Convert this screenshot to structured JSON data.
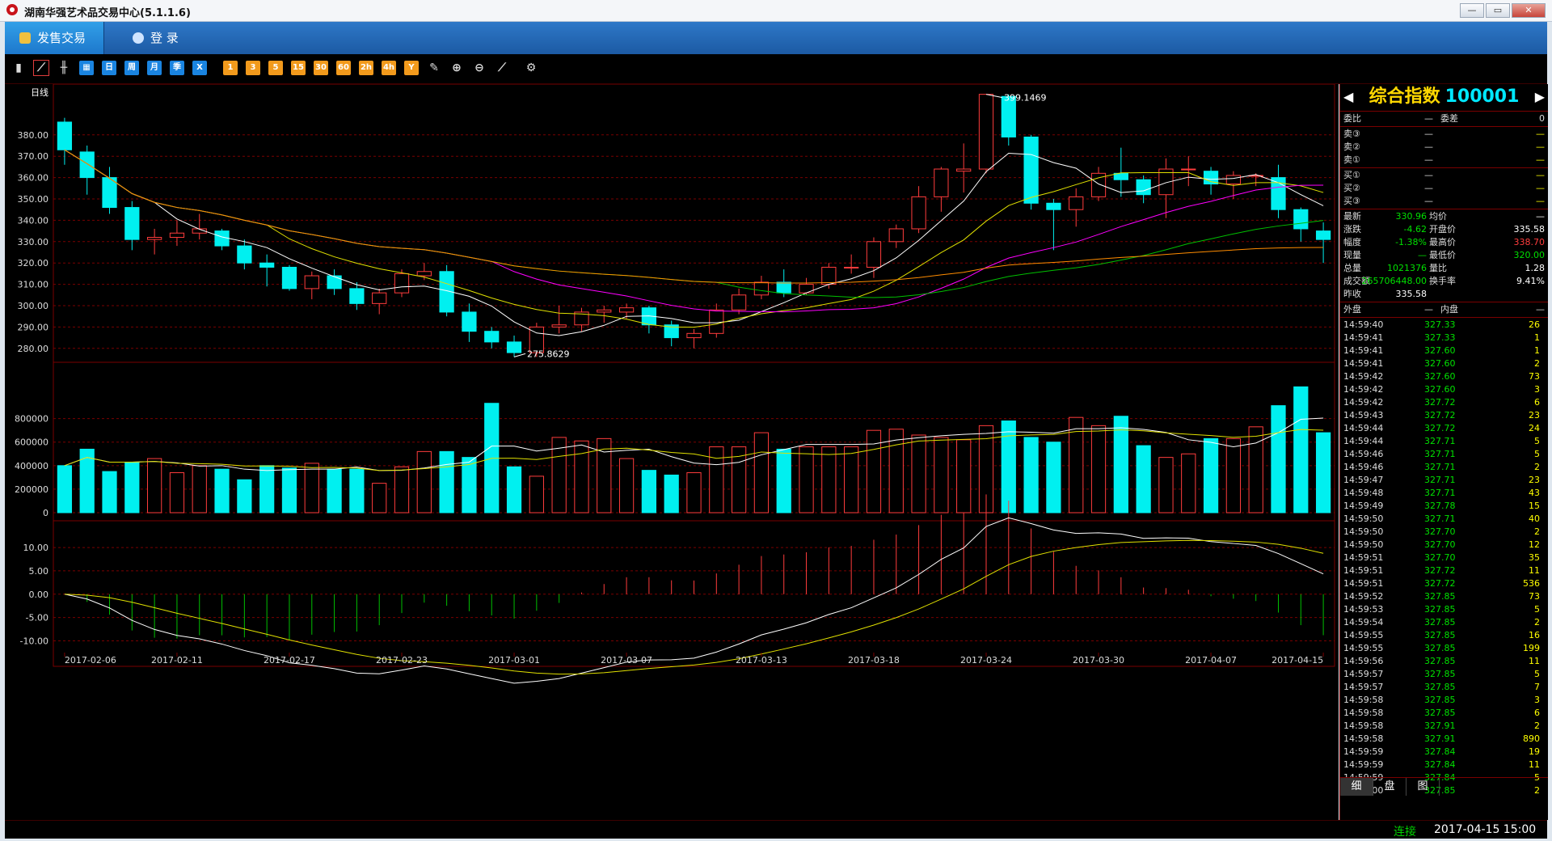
{
  "app": {
    "title": "湖南华强艺术品交易中心(5.1.1.6)",
    "win_buttons": [
      "—",
      "▭",
      "✕"
    ]
  },
  "menu": {
    "active_tab": "发售交易",
    "login_tab": "登   录"
  },
  "toolbar": {
    "buttons": [
      "bar-chart",
      "line-chart",
      "candle",
      "calendar",
      "日",
      "周",
      "月",
      "季",
      "X",
      "1",
      "3",
      "5",
      "15",
      "30",
      "60",
      "2h",
      "4h",
      "Y",
      "edit",
      "zoom-in",
      "zoom-out",
      "draw",
      "settings"
    ],
    "selected": "line-chart"
  },
  "chart": {
    "period_label": "日线",
    "price_axis": [
      "380.00",
      "370.00",
      "360.00",
      "350.00",
      "340.00",
      "330.00",
      "320.00",
      "310.00",
      "300.00",
      "290.00",
      "280.00"
    ],
    "high_label": "399.1469",
    "low_label": "275.8629",
    "volume_axis": [
      "800000",
      "600000",
      "400000",
      "200000",
      "0"
    ],
    "macd_axis": [
      "10.00",
      "5.00",
      "0.00",
      "-5.00",
      "-10.00"
    ],
    "date_axis": [
      "2017-02-06",
      "2017-02-11",
      "2017-02-17",
      "2017-02-23",
      "2017-03-01",
      "2017-03-07",
      "2017-03-13",
      "2017-03-18",
      "2017-03-24",
      "2017-03-30",
      "2017-04-07",
      "2017-04-15"
    ],
    "colors": {
      "up": "#ff3c3c",
      "down": "#00f0f0",
      "ma5": "#ffffff",
      "ma10": "#e0e000",
      "ma20": "#ff00ff",
      "ma30": "#00c000",
      "ma60": "#ff8c00"
    }
  },
  "chart_data": {
    "type": "candlestick",
    "ylim": [
      275,
      400
    ],
    "candles": [
      [
        386,
        373,
        388,
        366
      ],
      [
        372,
        360,
        375,
        352
      ],
      [
        360,
        346,
        365,
        343
      ],
      [
        346,
        331,
        349,
        326
      ],
      [
        331,
        332,
        336,
        324
      ],
      [
        332,
        334,
        340,
        328
      ],
      [
        334,
        336,
        343,
        331
      ],
      [
        335,
        328,
        336,
        326
      ],
      [
        328,
        320,
        331,
        317
      ],
      [
        320,
        318,
        324,
        309
      ],
      [
        318,
        308,
        319,
        307
      ],
      [
        308,
        314,
        316,
        303
      ],
      [
        314,
        308,
        317,
        305
      ],
      [
        308,
        301,
        311,
        298
      ],
      [
        301,
        306,
        308,
        296
      ],
      [
        306,
        315,
        317,
        304
      ],
      [
        314,
        316,
        320,
        312
      ],
      [
        316,
        297,
        319,
        295
      ],
      [
        297,
        288,
        301,
        283
      ],
      [
        288,
        283,
        290,
        280
      ],
      [
        283,
        278,
        286,
        276
      ],
      [
        278,
        290,
        292,
        276
      ],
      [
        290,
        291,
        300,
        287
      ],
      [
        291,
        297,
        299,
        288
      ],
      [
        297,
        298,
        300,
        292
      ],
      [
        297,
        299,
        301,
        294
      ],
      [
        299,
        291,
        300,
        287
      ],
      [
        291,
        285,
        293,
        281
      ],
      [
        285,
        287,
        289,
        280
      ],
      [
        287,
        298,
        301,
        285
      ],
      [
        298,
        305,
        308,
        296
      ],
      [
        305,
        311,
        314,
        303
      ],
      [
        311,
        306,
        317,
        304
      ],
      [
        306,
        310,
        313,
        305
      ],
      [
        310,
        318,
        320,
        308
      ],
      [
        318,
        318,
        324,
        315
      ],
      [
        318,
        330,
        332,
        313
      ],
      [
        330,
        336,
        338,
        327
      ],
      [
        336,
        351,
        356,
        334
      ],
      [
        351,
        364,
        365,
        344
      ],
      [
        363,
        364,
        376,
        353
      ],
      [
        364,
        399,
        399,
        362
      ],
      [
        398,
        379,
        399,
        375
      ],
      [
        379,
        348,
        380,
        345
      ],
      [
        348,
        345,
        350,
        326
      ],
      [
        345,
        351,
        355,
        337
      ],
      [
        351,
        362,
        365,
        349
      ],
      [
        362,
        359,
        374,
        351
      ],
      [
        359,
        352,
        361,
        348
      ],
      [
        352,
        364,
        369,
        341
      ],
      [
        364,
        364,
        370,
        356
      ],
      [
        363,
        357,
        365,
        352
      ],
      [
        357,
        361,
        363,
        350
      ],
      [
        361,
        361,
        362,
        356
      ],
      [
        360,
        345,
        366,
        341
      ],
      [
        345,
        336,
        346,
        330
      ],
      [
        335,
        331,
        339,
        320
      ]
    ],
    "volumes": [
      400000,
      540000,
      350000,
      430000,
      460000,
      340000,
      400000,
      370000,
      280000,
      400000,
      380000,
      420000,
      370000,
      370000,
      250000,
      390000,
      520000,
      520000,
      470000,
      930000,
      390000,
      310000,
      640000,
      610000,
      630000,
      460000,
      360000,
      320000,
      340000,
      560000,
      560000,
      680000,
      540000,
      560000,
      560000,
      560000,
      700000,
      710000,
      660000,
      640000,
      620000,
      740000,
      780000,
      640000,
      600000,
      810000,
      740000,
      820000,
      570000,
      470000,
      500000,
      630000,
      630000,
      730000,
      910000,
      1070000,
      680000
    ],
    "volume_unit_note": "",
    "macd_range": [
      -12,
      14
    ]
  },
  "quote": {
    "name": "综合指数",
    "code": "100001",
    "wb_label": "委比",
    "wb_val": "—",
    "wc_label": "委差",
    "wc_val": "0",
    "sells": [
      [
        "卖③",
        "—",
        "—"
      ],
      [
        "卖②",
        "—",
        "—"
      ],
      [
        "卖①",
        "—",
        "—"
      ]
    ],
    "buys": [
      [
        "买①",
        "—",
        "—"
      ],
      [
        "买②",
        "—",
        "—"
      ],
      [
        "买③",
        "—",
        "—"
      ]
    ],
    "stats": [
      [
        "最新",
        "330.96",
        "均价",
        "—"
      ],
      [
        "涨跌",
        "-4.62",
        "开盘价",
        "335.58"
      ],
      [
        "幅度",
        "-1.38%",
        "最高价",
        "338.70"
      ],
      [
        "现量",
        "—",
        "最低价",
        "320.00"
      ],
      [
        "总量",
        "1021376",
        "量比",
        "1.28"
      ],
      [
        "成交额",
        "265706448.00",
        "换手率",
        "9.41%"
      ],
      [
        "昨收",
        "335.58",
        "",
        ""
      ]
    ],
    "outer_label": "外盘",
    "outer_val": "—",
    "inner_label": "内盘",
    "inner_val": "—",
    "ticks": [
      [
        "14:59:40",
        "327.33",
        "26"
      ],
      [
        "14:59:41",
        "327.33",
        "1"
      ],
      [
        "14:59:41",
        "327.60",
        "1"
      ],
      [
        "14:59:41",
        "327.60",
        "2"
      ],
      [
        "14:59:42",
        "327.60",
        "73"
      ],
      [
        "14:59:42",
        "327.60",
        "3"
      ],
      [
        "14:59:42",
        "327.72",
        "6"
      ],
      [
        "14:59:43",
        "327.72",
        "23"
      ],
      [
        "14:59:44",
        "327.72",
        "24"
      ],
      [
        "14:59:44",
        "327.71",
        "5"
      ],
      [
        "14:59:46",
        "327.71",
        "5"
      ],
      [
        "14:59:46",
        "327.71",
        "2"
      ],
      [
        "14:59:47",
        "327.71",
        "23"
      ],
      [
        "14:59:48",
        "327.71",
        "43"
      ],
      [
        "14:59:49",
        "327.78",
        "15"
      ],
      [
        "14:59:50",
        "327.71",
        "40"
      ],
      [
        "14:59:50",
        "327.70",
        "2"
      ],
      [
        "14:59:50",
        "327.70",
        "12"
      ],
      [
        "14:59:51",
        "327.70",
        "35"
      ],
      [
        "14:59:51",
        "327.72",
        "11"
      ],
      [
        "14:59:51",
        "327.72",
        "536"
      ],
      [
        "14:59:52",
        "327.85",
        "73"
      ],
      [
        "14:59:53",
        "327.85",
        "5"
      ],
      [
        "14:59:54",
        "327.85",
        "2"
      ],
      [
        "14:59:55",
        "327.85",
        "16"
      ],
      [
        "14:59:55",
        "327.85",
        "199"
      ],
      [
        "14:59:56",
        "327.85",
        "11"
      ],
      [
        "14:59:57",
        "327.85",
        "5"
      ],
      [
        "14:59:57",
        "327.85",
        "7"
      ],
      [
        "14:59:58",
        "327.85",
        "3"
      ],
      [
        "14:59:58",
        "327.85",
        "6"
      ],
      [
        "14:59:58",
        "327.91",
        "2"
      ],
      [
        "14:59:58",
        "327.91",
        "890"
      ],
      [
        "14:59:59",
        "327.84",
        "19"
      ],
      [
        "14:59:59",
        "327.84",
        "11"
      ],
      [
        "14:59:59",
        "327.84",
        "5"
      ],
      [
        "15:00:00",
        "327.85",
        "2"
      ]
    ],
    "tabs": [
      "细",
      "盘",
      "图"
    ]
  },
  "status": {
    "connection": "连接",
    "time": "2017-04-15 15:00"
  }
}
